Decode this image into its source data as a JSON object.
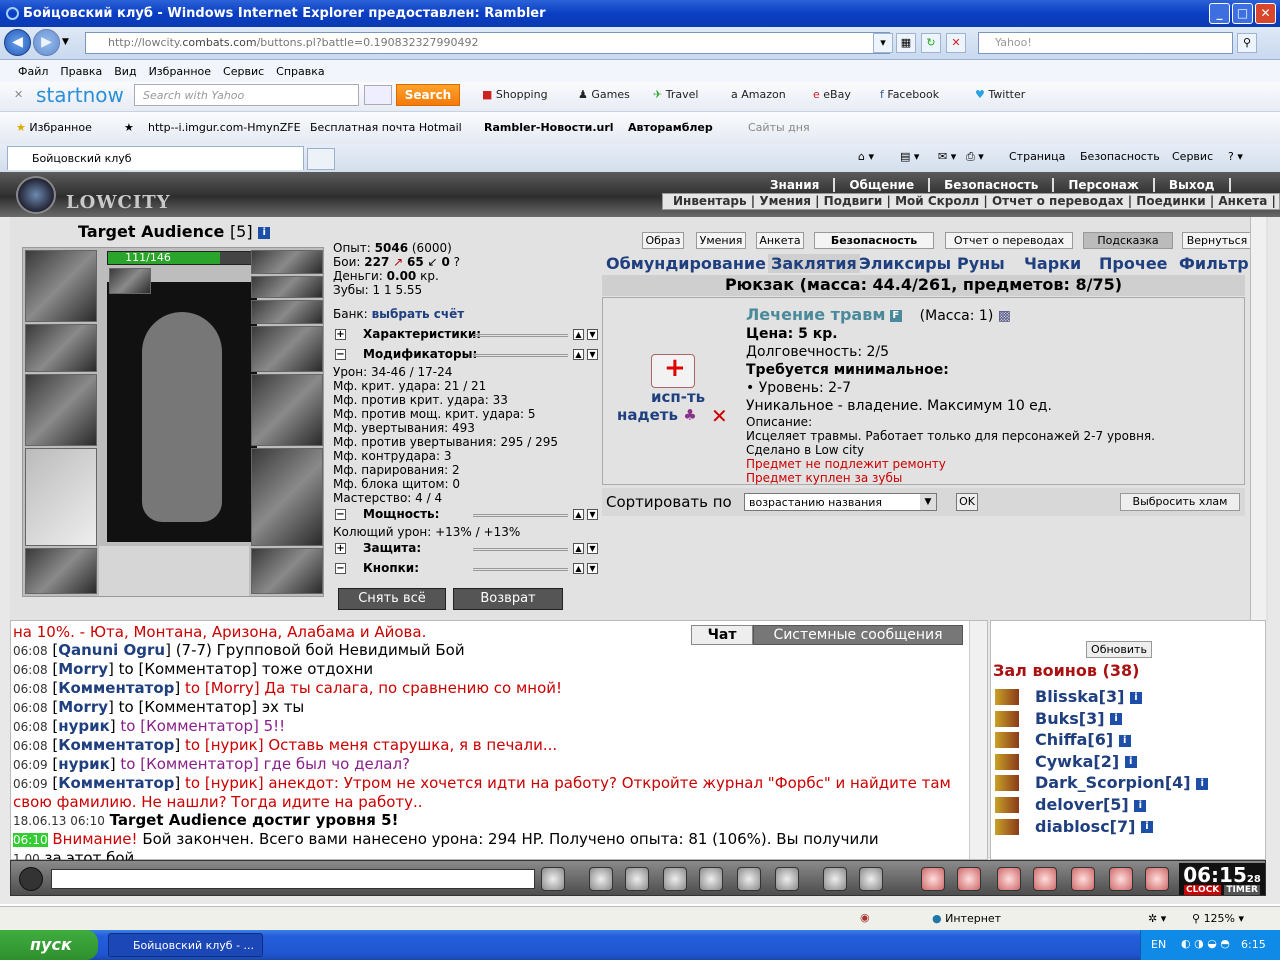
{
  "window": {
    "title": "Бойцовский клуб - Windows Internet Explorer предоставлен: Rambler"
  },
  "address": {
    "url_prefix": "http://lowcity.",
    "url_domain": "combats.com",
    "url_rest": "/buttons.pl?battle=0.190832327990492",
    "search_placeholder": "Yahoo!"
  },
  "menu": [
    "Файл",
    "Правка",
    "Вид",
    "Избранное",
    "Сервис",
    "Справка"
  ],
  "startnow": {
    "logo_start": "start",
    "logo_now": "now",
    "search_placeholder": "Search with Yahoo",
    "search_button": "Search",
    "links": [
      "Shopping",
      "Games",
      "Travel",
      "Amazon",
      "eBay",
      "Facebook",
      "Twitter"
    ]
  },
  "favorites": {
    "label": "Избранное",
    "items": [
      "http--i.imgur.com-HmynZFE",
      "Бесплатная почта Hotmail",
      "Rambler-Новости.url",
      "Авторамблер",
      "Сайты дня"
    ]
  },
  "tabs": {
    "active": "Бойцовский клуб"
  },
  "commandbar": [
    "Страница",
    "Безопасность",
    "Сервис"
  ],
  "game": {
    "logo": "LOWCITY",
    "topnav1": [
      "Знания",
      "Общение",
      "Безопасность",
      "Персонаж",
      "Выход"
    ],
    "topnav2": "Инвентарь | Умения | Подвиги | Мой Скролл | Отчет о переводах | Поединки | Анкета | Ко",
    "char": {
      "name": "Target Audience",
      "level": "[5]",
      "hp": "111/146",
      "hp_fraction": 0.76
    },
    "stats": {
      "exp_label": "Опыт:",
      "exp": "5046",
      "exp_next": "(6000)",
      "fights_label": "Бои:",
      "wins": "227",
      "losses": "65",
      "draws": "0",
      "money_label": "Деньги:",
      "money": "0.00",
      "money_unit": "кр.",
      "teeth_label": "Зубы:",
      "teeth": "1  1  5.55",
      "bank_label": "Банк:",
      "bank_link": "выбрать счёт"
    },
    "sections": {
      "characteristics": "Характеристики:",
      "modifiers": "Модификаторы:",
      "power": "Мощность:",
      "protection": "Защита:",
      "buttons": "Кнопки:"
    },
    "modifiers": [
      "Урон: 34-46 / 17-24",
      "Мф. крит. удара: 21 / 21",
      "Мф. против крит. удара: 33",
      "Мф. против мощ. крит. удара: 5",
      "Мф. увертывания: 493",
      "Мф. против увертывания: 295 / 295",
      "Мф. контрудара: 3",
      "Мф. парирования: 2",
      "Мф. блока щитом: 0",
      "Мастерство: 4 / 4"
    ],
    "power_line": "Колющий урон: +13% / +13%",
    "btn_remove_all": "Снять всё",
    "btn_return": "Возврат",
    "top_buttons": [
      "Образ",
      "Умения",
      "Анкета",
      "Безопасность",
      "Отчет о переводах",
      "Подсказка",
      "Вернуться"
    ],
    "inv_tabs": [
      "Обмундирование",
      "Заклятия",
      "Эликсиры",
      "Руны",
      "Чарки",
      "Прочее",
      "Фильтр"
    ],
    "rucksack": "Рюкзак (масса: 44.4/261, предметов: 8/75)",
    "item": {
      "name": "Лечение травм",
      "mass": "(Масса: 1)",
      "price": "Цена: 5 кр.",
      "durability": "Долговечность: 2/5",
      "req_title": "Требуется минимальное:",
      "req_level": "• Уровень: 2-7",
      "unique": "Уникальное - владение. Максимум 10 ед.",
      "desc_label": "Описание:",
      "desc": "Исцеляет травмы. Работает только для персонажей 2-7 уровня.",
      "made": "Сделано в Low city",
      "no_repair": "Предмет не подлежит ремонту",
      "bought": "Предмет куплен за зубы",
      "use": "исп-ть",
      "wear": "надеть"
    },
    "sort": {
      "label": "Сортировать по",
      "selected": "возрастанию названия",
      "ok": "OK",
      "throw": "Выбросить хлам"
    }
  },
  "chat": {
    "tab_chat": "Чат",
    "tab_system": "Системные сообщения",
    "lines": [
      {
        "time": "",
        "text": "на 10%. - Юта, Монтана, Аризона, Алабама и Айова.",
        "style": "red"
      },
      {
        "time": "06:08",
        "name": "Qanuni Ogru",
        "text": " (7-7) Групповой бой Невидимый Бой",
        "style": "normal"
      },
      {
        "time": "06:08",
        "name": "Morry",
        "text": " to [Комментатор] тоже отдохни",
        "style": "normal"
      },
      {
        "time": "06:08",
        "name": "Комментатор",
        "text": " to [Morry] Да ты салага, по сравнению со мной!",
        "style": "red"
      },
      {
        "time": "06:08",
        "name": "Morry",
        "text": " to [Комментатор] эх ты",
        "style": "normal"
      },
      {
        "time": "06:08",
        "name": "нурик",
        "text": " to [Комментатор] 5!!",
        "style": "purple"
      },
      {
        "time": "06:08",
        "name": "Комментатор",
        "text": " to [нурик] Оставь меня старушка, я в печали...",
        "style": "red"
      },
      {
        "time": "06:09",
        "name": "нурик",
        "text": " to [Комментатор] где был чо делал?",
        "style": "purple"
      },
      {
        "time": "06:09",
        "name": "Комментатор",
        "text": " to [нурик] анекдот: Утром не хочется идти на работу? Откройте журнал \"Форбс\" и найдите там свою фамилию. Не нашли? Тогда идите на работу..",
        "style": "red"
      }
    ],
    "levelup_time": "18.06.13 06:10",
    "levelup": "Target Audience достиг уровня 5!",
    "system_time": "06:10",
    "system_warn": "Внимание!",
    "system_text": "Бой закончен. Всего вами нанесено урона: 294 HP. Получено опыта: 81 (106%). Вы получили",
    "system_teeth": "1.00",
    "system_tail": "за этот бой."
  },
  "players": {
    "refresh": "Обновить",
    "hall": "Зал воинов (38)",
    "list": [
      "Blisska[3]",
      "Buks[3]",
      "Chiffa[6]",
      "Cywka[2]",
      "Dark_Scorpion[4]",
      "delover[5]",
      "diablosc[7]"
    ]
  },
  "clock": {
    "time": "06:15",
    "seconds": "28",
    "clock_label": "CLOCK",
    "timer_label": "TIMER"
  },
  "status": {
    "zone": "Интернет",
    "zoom": "125%"
  },
  "taskbar": {
    "start": "пуск",
    "item": "Бойцовский клуб - ...",
    "lang": "EN",
    "time": "6:15"
  }
}
